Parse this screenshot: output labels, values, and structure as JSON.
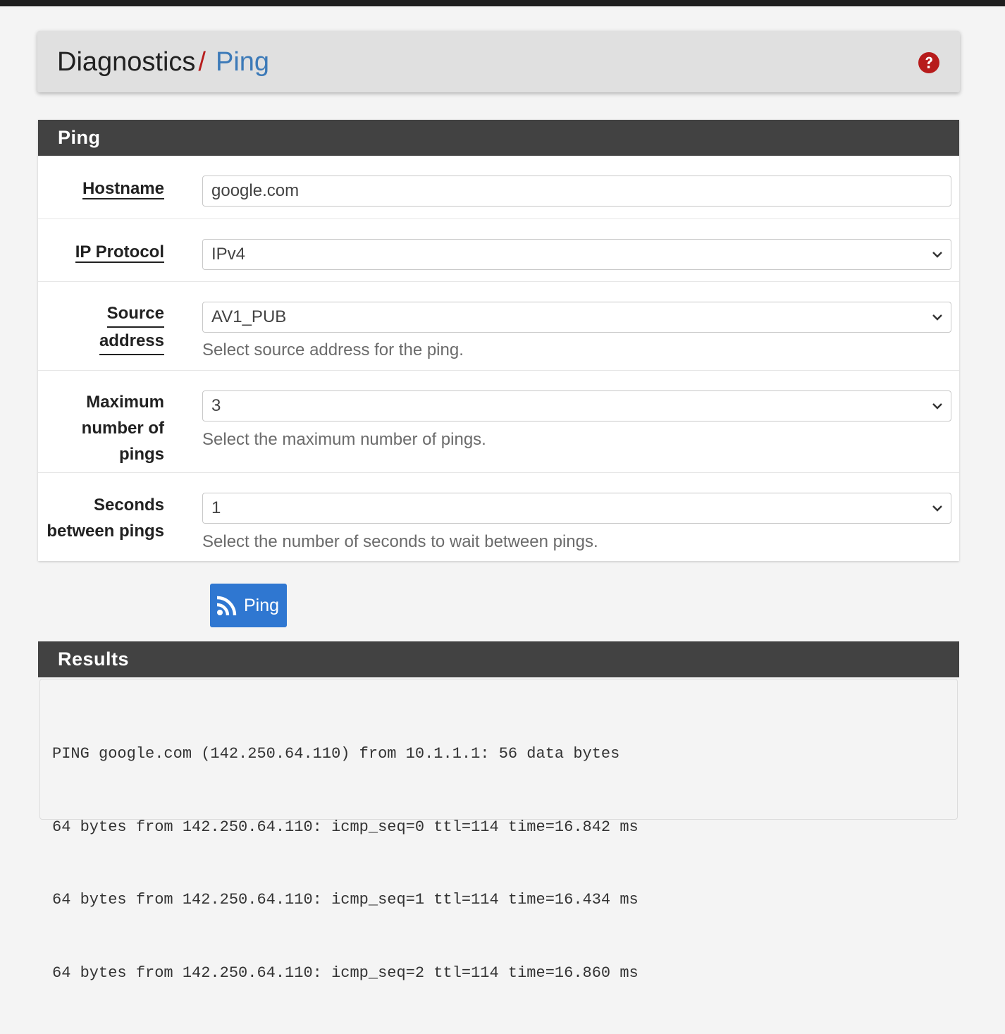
{
  "breadcrumb": {
    "root": "Diagnostics",
    "separator": "/",
    "current": "Ping"
  },
  "help_icon": "question-circle-icon",
  "form": {
    "heading": "Ping",
    "hostname": {
      "label": "Hostname",
      "value": "google.com"
    },
    "ip_protocol": {
      "label": "IP Protocol",
      "value": "IPv4"
    },
    "source_address": {
      "label_line1": "Source",
      "label_line2": "address",
      "value": "AV1_PUB",
      "help": "Select source address for the ping."
    },
    "max_pings": {
      "label_line1": "Maximum",
      "label_line2": "number of",
      "label_line3": "pings",
      "value": "3",
      "help": "Select the maximum number of pings."
    },
    "seconds_between": {
      "label_line1": "Seconds",
      "label_line2": "between pings",
      "value": "1",
      "help": "Select the number of seconds to wait between pings."
    }
  },
  "ping_button": {
    "label": "Ping",
    "icon": "rss-icon"
  },
  "results": {
    "heading": "Results",
    "lines": [
      "PING google.com (142.250.64.110) from 10.1.1.1: 56 data bytes",
      "64 bytes from 142.250.64.110: icmp_seq=0 ttl=114 time=16.842 ms",
      "64 bytes from 142.250.64.110: icmp_seq=1 ttl=114 time=16.434 ms",
      "64 bytes from 142.250.64.110: icmp_seq=2 ttl=114 time=16.860 ms"
    ]
  },
  "colors": {
    "accent_blue": "#2f77d1",
    "breadcrumb_link": "#3c7ab8",
    "separator_red": "#b71c1c",
    "panel_heading": "#424242"
  }
}
